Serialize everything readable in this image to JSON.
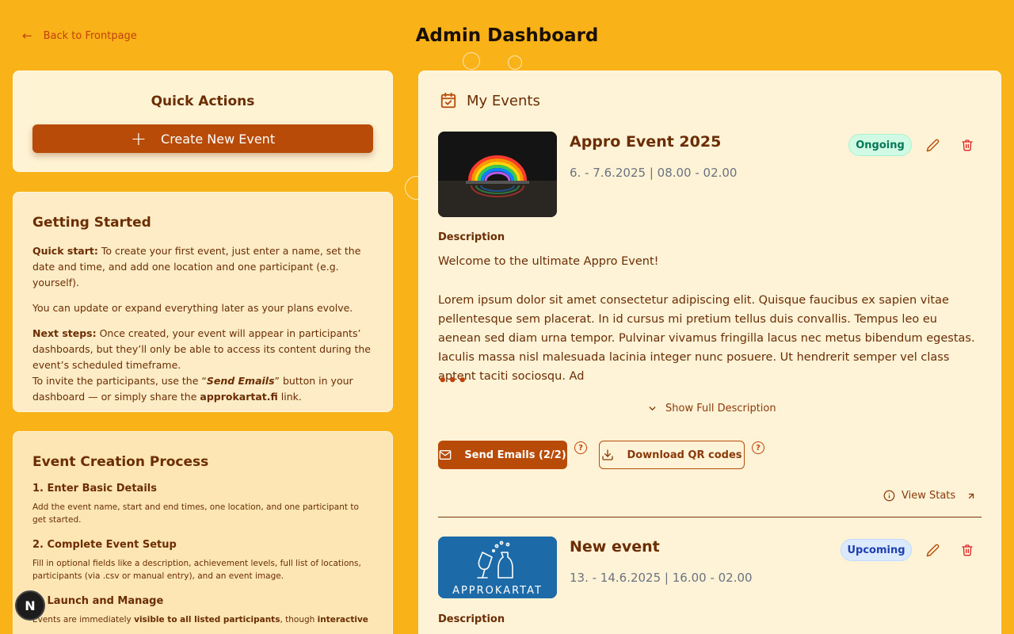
{
  "nav": {
    "back_label": "Back to Frontpage"
  },
  "page": {
    "title": "Admin Dashboard"
  },
  "quick_actions": {
    "title": "Quick Actions",
    "create_label": "Create New Event"
  },
  "getting_started": {
    "title": "Getting Started",
    "quick_start_label": "Quick start:",
    "quick_start_text": " To create your first event, just enter a name, set the date and time, and add one location and one participant (e.g. yourself).",
    "update_text": "You can update or expand everything later as your plans evolve.",
    "next_steps_label": "Next steps:",
    "next_steps_text": " Once created, your event will appear in participants’ dashboards, but they’ll only be able to access its content during the event’s scheduled timeframe.",
    "invite_prefix": "To invite the participants, use the “",
    "invite_button_name": "Send Emails",
    "invite_middle": "” button in your dashboard — or simply share the ",
    "invite_link": "approkartat.fi",
    "invite_suffix": " link."
  },
  "process": {
    "title": "Event Creation Process",
    "steps": [
      {
        "title": "1. Enter Basic Details",
        "text": "Add the event name, start and end times, one location, and one participant to get started."
      },
      {
        "title": "2. Complete Event Setup",
        "text": "Fill in optional fields like a description, achievement levels, full list of locations, participants (via .csv or manual entry), and an event image."
      },
      {
        "title": "3. Launch and Manage",
        "text_prefix": "Events are immediately ",
        "text_bold": "visible to all listed participants",
        "text_suffix": ", though ",
        "text_bold2": "interactive"
      }
    ]
  },
  "my_events": {
    "title": "My Events",
    "events": [
      {
        "title": "Appro Event 2025",
        "date": "6. - 7.6.2025 |  08.00 - 02.00",
        "status": "Ongoing",
        "description_label": "Description",
        "description_line1": "Welcome to the ultimate Appro Event!",
        "description_para": "Lorem ipsum dolor sit amet consectetur adipiscing elit. Quisque faucibus ex sapien vitae pellentesque sem placerat. In id cursus mi pretium tellus duis convallis. Tempus leo eu aenean sed diam urna tempor. Pulvinar vivamus fringilla lacus nec metus bibendum egestas. Iaculis massa nisl malesuada lacinia integer nunc posuere. Ut hendrerit semper vel class aptent taciti sociosqu. Ad",
        "ellipsis": "•••",
        "show_full_label": "Show Full Description",
        "send_emails_label": "Send Emails (2/2)",
        "download_qr_label": "Download QR codes",
        "view_stats_label": "View Stats"
      },
      {
        "title": "New event",
        "date": "13. - 14.6.2025 |  16.00 - 02.00",
        "status": "Upcoming",
        "description_label": "Description",
        "image_text": "APPROKARTAT"
      }
    ]
  },
  "fab": {
    "label": "N"
  },
  "colors": {
    "background": "#f9b217",
    "accent": "#b84b07",
    "text": "#6b2d04"
  }
}
